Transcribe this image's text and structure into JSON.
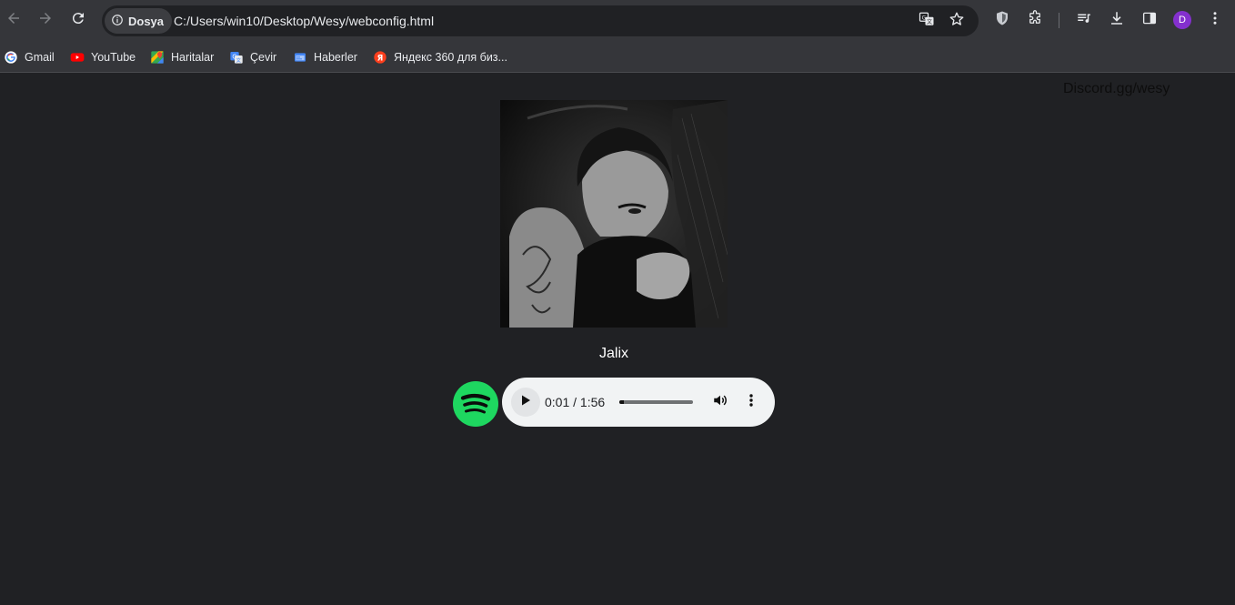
{
  "browser": {
    "site_chip_label": "Dosya",
    "url": "C:/Users/win10/Desktop/Wesy/webconfig.html",
    "profile_initial": "D",
    "accent_colors": {
      "toolbar": "#35363a",
      "omnibox": "#202124",
      "profile": "#8430ce"
    },
    "icons": [
      "back-icon",
      "forward-icon",
      "reload-icon",
      "info-icon",
      "translate-icon",
      "star-icon",
      "shield-icon",
      "extensions-icon",
      "media-queue-icon",
      "download-icon",
      "side-panel-icon",
      "menu-icon"
    ]
  },
  "bookmarks": [
    {
      "label": "Gmail",
      "icon": "google-icon"
    },
    {
      "label": "YouTube",
      "icon": "youtube-icon"
    },
    {
      "label": "Haritalar",
      "icon": "maps-icon"
    },
    {
      "label": "Çevir",
      "icon": "translate-icon"
    },
    {
      "label": "Haberler",
      "icon": "news-icon"
    },
    {
      "label": "Яндекс 360 для биз...",
      "icon": "yandex-icon"
    }
  ],
  "page": {
    "discord_text": "Discord.gg/wesy",
    "track_title": "Jalix",
    "background": "#202124",
    "spotify_color": "#1ed760",
    "player": {
      "time_display": "0:01 / 1:56",
      "progress_fraction": 0.009
    }
  }
}
